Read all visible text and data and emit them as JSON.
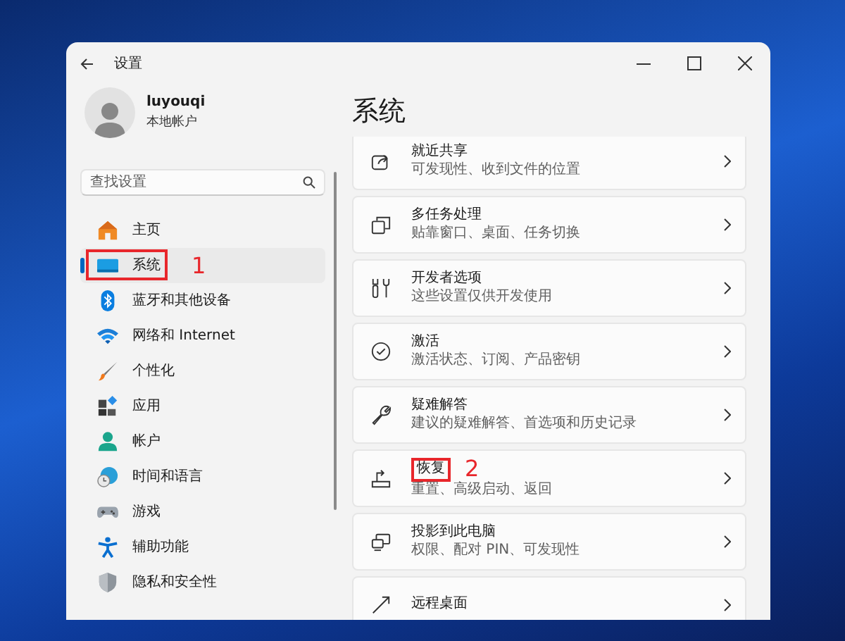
{
  "window": {
    "title": "设置"
  },
  "account": {
    "name": "luyouqi",
    "type": "本地帐户"
  },
  "search": {
    "placeholder": "查找设置"
  },
  "nav": [
    {
      "label": "主页",
      "kind": "home",
      "selected": false
    },
    {
      "label": "系统",
      "kind": "system",
      "selected": true,
      "annotation": "1"
    },
    {
      "label": "蓝牙和其他设备",
      "kind": "bluetooth",
      "selected": false
    },
    {
      "label": "网络和 Internet",
      "kind": "wifi",
      "selected": false
    },
    {
      "label": "个性化",
      "kind": "brush",
      "selected": false
    },
    {
      "label": "应用",
      "kind": "apps",
      "selected": false
    },
    {
      "label": "帐户",
      "kind": "person",
      "selected": false
    },
    {
      "label": "时间和语言",
      "kind": "globe",
      "selected": false
    },
    {
      "label": "游戏",
      "kind": "gamepad",
      "selected": false
    },
    {
      "label": "辅助功能",
      "kind": "access",
      "selected": false
    },
    {
      "label": "隐私和安全性",
      "kind": "shield",
      "selected": false
    }
  ],
  "page_title": "系统",
  "cards": [
    {
      "title": "就近共享",
      "subtitle": "可发现性、收到文件的位置",
      "kind": "share"
    },
    {
      "title": "多任务处理",
      "subtitle": "贴靠窗口、桌面、任务切换",
      "kind": "windows"
    },
    {
      "title": "开发者选项",
      "subtitle": "这些设置仅供开发使用",
      "kind": "tools"
    },
    {
      "title": "激活",
      "subtitle": "激活状态、订阅、产品密钥",
      "kind": "check"
    },
    {
      "title": "疑难解答",
      "subtitle": "建议的疑难解答、首选项和历史记录",
      "kind": "wrench"
    },
    {
      "title": "恢复",
      "subtitle": "重置、高级启动、返回",
      "kind": "recovery",
      "annotation": "2"
    },
    {
      "title": "投影到此电脑",
      "subtitle": "权限、配对 PIN、可发现性",
      "kind": "project"
    },
    {
      "title": "远程桌面",
      "kind": "remote"
    }
  ]
}
